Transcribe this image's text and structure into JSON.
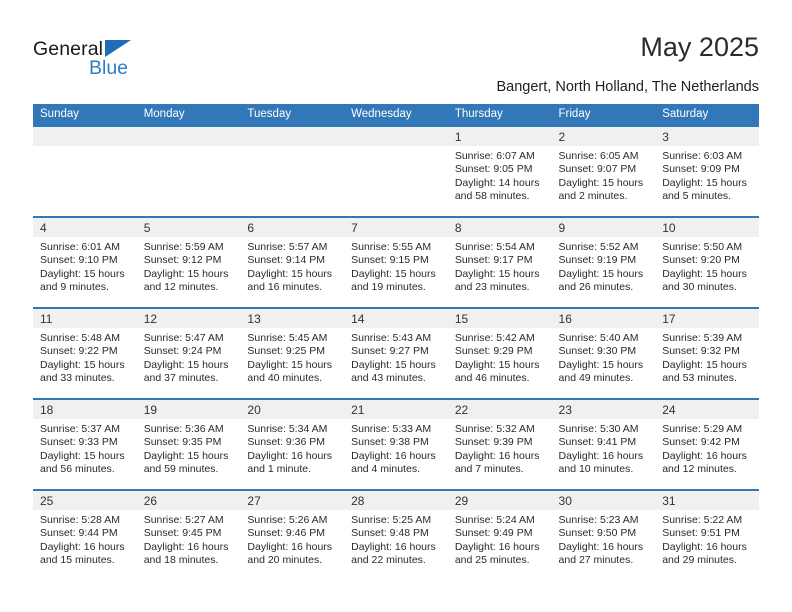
{
  "logo": {
    "word_one": "General",
    "word_two": "Blue",
    "triangle_color": "#1f6eb5",
    "blue_color": "#2b7fc6"
  },
  "header": {
    "title": "May 2025",
    "subtitle": "Bangert, North Holland, The Netherlands"
  },
  "theme": {
    "header_blue": "#3278b8",
    "day_band_gray": "#f0f0f0",
    "text": "#2a2a2a"
  },
  "weekday_headers": [
    "Sunday",
    "Monday",
    "Tuesday",
    "Wednesday",
    "Thursday",
    "Friday",
    "Saturday"
  ],
  "labels": {
    "sunrise": "Sunrise:",
    "sunset": "Sunset:",
    "daylight": "Daylight:"
  },
  "weeks": [
    [
      {
        "day": "",
        "sunrise": "",
        "sunset": "",
        "daylight_line1": "",
        "daylight_line2": ""
      },
      {
        "day": "",
        "sunrise": "",
        "sunset": "",
        "daylight_line1": "",
        "daylight_line2": ""
      },
      {
        "day": "",
        "sunrise": "",
        "sunset": "",
        "daylight_line1": "",
        "daylight_line2": ""
      },
      {
        "day": "",
        "sunrise": "",
        "sunset": "",
        "daylight_line1": "",
        "daylight_line2": ""
      },
      {
        "day": "1",
        "sunrise": "Sunrise: 6:07 AM",
        "sunset": "Sunset: 9:05 PM",
        "daylight_line1": "Daylight: 14 hours",
        "daylight_line2": "and 58 minutes."
      },
      {
        "day": "2",
        "sunrise": "Sunrise: 6:05 AM",
        "sunset": "Sunset: 9:07 PM",
        "daylight_line1": "Daylight: 15 hours",
        "daylight_line2": "and 2 minutes."
      },
      {
        "day": "3",
        "sunrise": "Sunrise: 6:03 AM",
        "sunset": "Sunset: 9:09 PM",
        "daylight_line1": "Daylight: 15 hours",
        "daylight_line2": "and 5 minutes."
      }
    ],
    [
      {
        "day": "4",
        "sunrise": "Sunrise: 6:01 AM",
        "sunset": "Sunset: 9:10 PM",
        "daylight_line1": "Daylight: 15 hours",
        "daylight_line2": "and 9 minutes."
      },
      {
        "day": "5",
        "sunrise": "Sunrise: 5:59 AM",
        "sunset": "Sunset: 9:12 PM",
        "daylight_line1": "Daylight: 15 hours",
        "daylight_line2": "and 12 minutes."
      },
      {
        "day": "6",
        "sunrise": "Sunrise: 5:57 AM",
        "sunset": "Sunset: 9:14 PM",
        "daylight_line1": "Daylight: 15 hours",
        "daylight_line2": "and 16 minutes."
      },
      {
        "day": "7",
        "sunrise": "Sunrise: 5:55 AM",
        "sunset": "Sunset: 9:15 PM",
        "daylight_line1": "Daylight: 15 hours",
        "daylight_line2": "and 19 minutes."
      },
      {
        "day": "8",
        "sunrise": "Sunrise: 5:54 AM",
        "sunset": "Sunset: 9:17 PM",
        "daylight_line1": "Daylight: 15 hours",
        "daylight_line2": "and 23 minutes."
      },
      {
        "day": "9",
        "sunrise": "Sunrise: 5:52 AM",
        "sunset": "Sunset: 9:19 PM",
        "daylight_line1": "Daylight: 15 hours",
        "daylight_line2": "and 26 minutes."
      },
      {
        "day": "10",
        "sunrise": "Sunrise: 5:50 AM",
        "sunset": "Sunset: 9:20 PM",
        "daylight_line1": "Daylight: 15 hours",
        "daylight_line2": "and 30 minutes."
      }
    ],
    [
      {
        "day": "11",
        "sunrise": "Sunrise: 5:48 AM",
        "sunset": "Sunset: 9:22 PM",
        "daylight_line1": "Daylight: 15 hours",
        "daylight_line2": "and 33 minutes."
      },
      {
        "day": "12",
        "sunrise": "Sunrise: 5:47 AM",
        "sunset": "Sunset: 9:24 PM",
        "daylight_line1": "Daylight: 15 hours",
        "daylight_line2": "and 37 minutes."
      },
      {
        "day": "13",
        "sunrise": "Sunrise: 5:45 AM",
        "sunset": "Sunset: 9:25 PM",
        "daylight_line1": "Daylight: 15 hours",
        "daylight_line2": "and 40 minutes."
      },
      {
        "day": "14",
        "sunrise": "Sunrise: 5:43 AM",
        "sunset": "Sunset: 9:27 PM",
        "daylight_line1": "Daylight: 15 hours",
        "daylight_line2": "and 43 minutes."
      },
      {
        "day": "15",
        "sunrise": "Sunrise: 5:42 AM",
        "sunset": "Sunset: 9:29 PM",
        "daylight_line1": "Daylight: 15 hours",
        "daylight_line2": "and 46 minutes."
      },
      {
        "day": "16",
        "sunrise": "Sunrise: 5:40 AM",
        "sunset": "Sunset: 9:30 PM",
        "daylight_line1": "Daylight: 15 hours",
        "daylight_line2": "and 49 minutes."
      },
      {
        "day": "17",
        "sunrise": "Sunrise: 5:39 AM",
        "sunset": "Sunset: 9:32 PM",
        "daylight_line1": "Daylight: 15 hours",
        "daylight_line2": "and 53 minutes."
      }
    ],
    [
      {
        "day": "18",
        "sunrise": "Sunrise: 5:37 AM",
        "sunset": "Sunset: 9:33 PM",
        "daylight_line1": "Daylight: 15 hours",
        "daylight_line2": "and 56 minutes."
      },
      {
        "day": "19",
        "sunrise": "Sunrise: 5:36 AM",
        "sunset": "Sunset: 9:35 PM",
        "daylight_line1": "Daylight: 15 hours",
        "daylight_line2": "and 59 minutes."
      },
      {
        "day": "20",
        "sunrise": "Sunrise: 5:34 AM",
        "sunset": "Sunset: 9:36 PM",
        "daylight_line1": "Daylight: 16 hours",
        "daylight_line2": "and 1 minute."
      },
      {
        "day": "21",
        "sunrise": "Sunrise: 5:33 AM",
        "sunset": "Sunset: 9:38 PM",
        "daylight_line1": "Daylight: 16 hours",
        "daylight_line2": "and 4 minutes."
      },
      {
        "day": "22",
        "sunrise": "Sunrise: 5:32 AM",
        "sunset": "Sunset: 9:39 PM",
        "daylight_line1": "Daylight: 16 hours",
        "daylight_line2": "and 7 minutes."
      },
      {
        "day": "23",
        "sunrise": "Sunrise: 5:30 AM",
        "sunset": "Sunset: 9:41 PM",
        "daylight_line1": "Daylight: 16 hours",
        "daylight_line2": "and 10 minutes."
      },
      {
        "day": "24",
        "sunrise": "Sunrise: 5:29 AM",
        "sunset": "Sunset: 9:42 PM",
        "daylight_line1": "Daylight: 16 hours",
        "daylight_line2": "and 12 minutes."
      }
    ],
    [
      {
        "day": "25",
        "sunrise": "Sunrise: 5:28 AM",
        "sunset": "Sunset: 9:44 PM",
        "daylight_line1": "Daylight: 16 hours",
        "daylight_line2": "and 15 minutes."
      },
      {
        "day": "26",
        "sunrise": "Sunrise: 5:27 AM",
        "sunset": "Sunset: 9:45 PM",
        "daylight_line1": "Daylight: 16 hours",
        "daylight_line2": "and 18 minutes."
      },
      {
        "day": "27",
        "sunrise": "Sunrise: 5:26 AM",
        "sunset": "Sunset: 9:46 PM",
        "daylight_line1": "Daylight: 16 hours",
        "daylight_line2": "and 20 minutes."
      },
      {
        "day": "28",
        "sunrise": "Sunrise: 5:25 AM",
        "sunset": "Sunset: 9:48 PM",
        "daylight_line1": "Daylight: 16 hours",
        "daylight_line2": "and 22 minutes."
      },
      {
        "day": "29",
        "sunrise": "Sunrise: 5:24 AM",
        "sunset": "Sunset: 9:49 PM",
        "daylight_line1": "Daylight: 16 hours",
        "daylight_line2": "and 25 minutes."
      },
      {
        "day": "30",
        "sunrise": "Sunrise: 5:23 AM",
        "sunset": "Sunset: 9:50 PM",
        "daylight_line1": "Daylight: 16 hours",
        "daylight_line2": "and 27 minutes."
      },
      {
        "day": "31",
        "sunrise": "Sunrise: 5:22 AM",
        "sunset": "Sunset: 9:51 PM",
        "daylight_line1": "Daylight: 16 hours",
        "daylight_line2": "and 29 minutes."
      }
    ]
  ]
}
